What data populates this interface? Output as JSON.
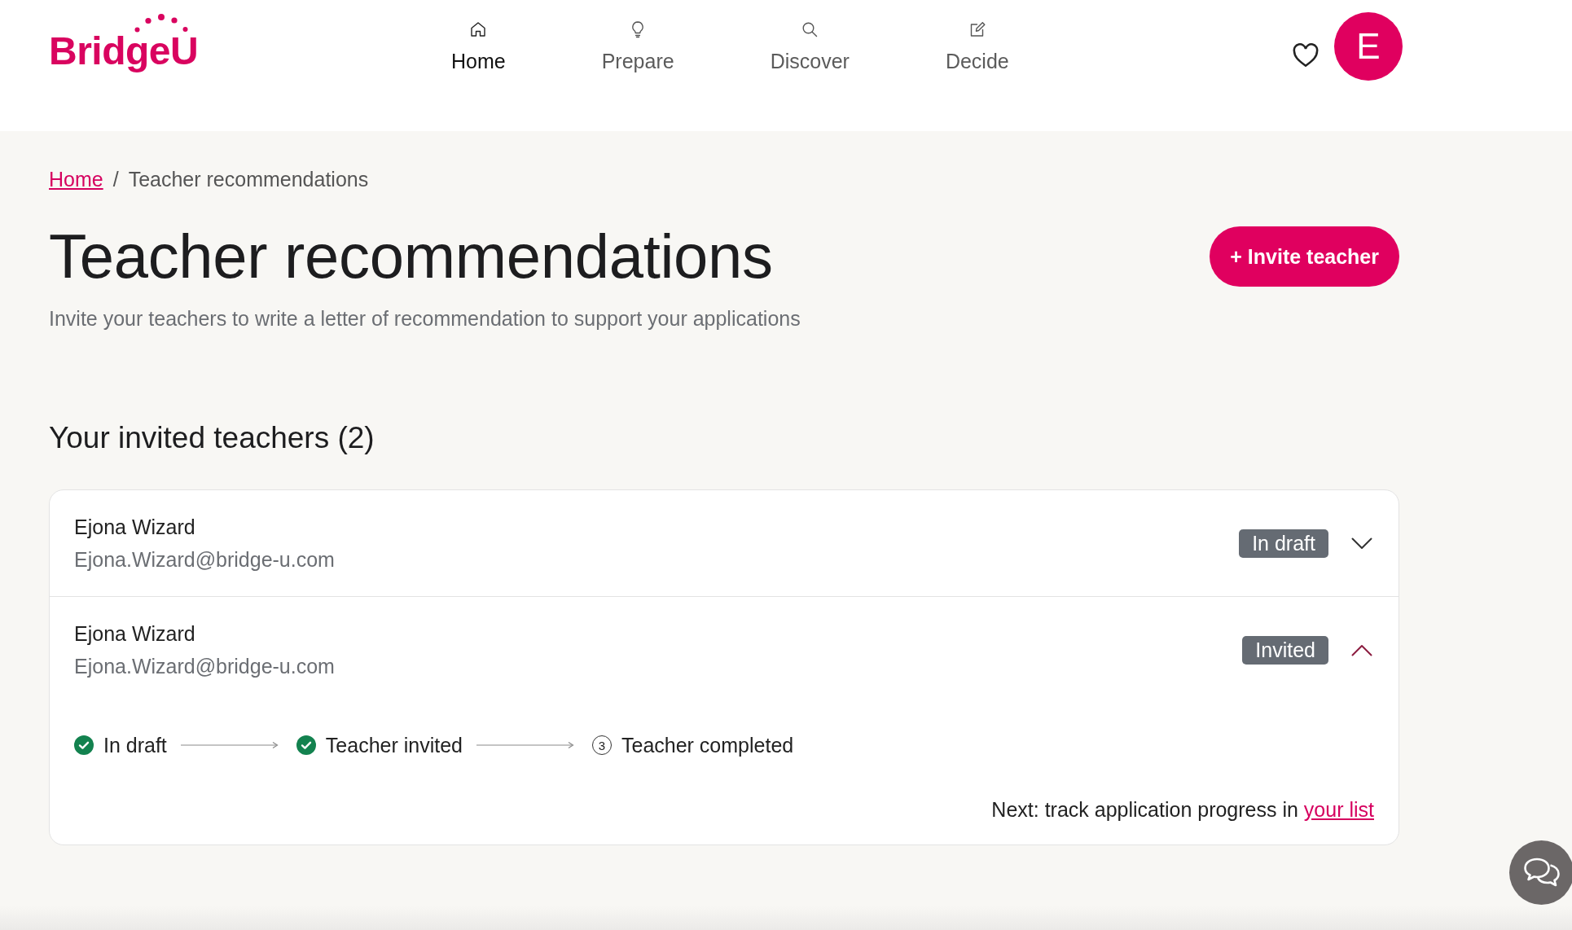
{
  "header": {
    "logo": "BridgeU",
    "nav": [
      {
        "label": "Home",
        "selected": true
      },
      {
        "label": "Prepare",
        "selected": false
      },
      {
        "label": "Discover",
        "selected": false
      },
      {
        "label": "Decide",
        "selected": false
      }
    ],
    "avatar": "E"
  },
  "breadcrumb": {
    "items": [
      {
        "label": "Home",
        "kind": "link"
      },
      {
        "label": "Teacher recommendations",
        "kind": "current"
      }
    ],
    "separator": "/"
  },
  "page": {
    "title": "Teacher recommendations",
    "subtitle": "Invite your teachers to write a letter of recommendation to support your applications",
    "invite_button": "+ Invite teacher"
  },
  "teachers_section": {
    "title": "Your invited teachers (2)",
    "teachers": [
      {
        "name": "Ejona Wizard",
        "email": "Ejona.Wizard@bridge-u.com",
        "status": "In draft",
        "expanded": false
      },
      {
        "name": "Ejona Wizard",
        "email": "Ejona.Wizard@bridge-u.com",
        "status": "Invited",
        "expanded": true,
        "progress": [
          {
            "label": "In draft",
            "done": true
          },
          {
            "label": "Teacher invited",
            "done": true
          },
          {
            "label": "Teacher completed",
            "done": false,
            "number": "3"
          }
        ],
        "next_step": {
          "text": "Next: track application progress in",
          "link": "your list"
        }
      }
    ]
  }
}
